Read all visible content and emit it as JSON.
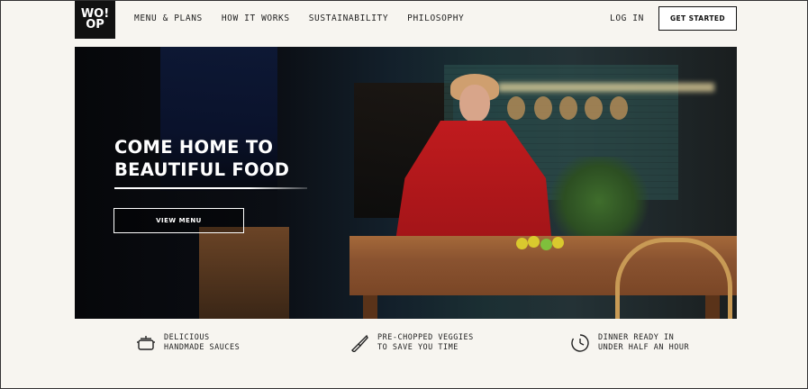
{
  "brand": {
    "logo_line1": "WO!",
    "logo_line2": "OP"
  },
  "nav": {
    "items": [
      {
        "label": "MENU & PLANS"
      },
      {
        "label": "HOW IT WORKS"
      },
      {
        "label": "SUSTAINABILITY"
      },
      {
        "label": "PHILOSOPHY"
      }
    ],
    "login": "LOG IN",
    "cta": "GET STARTED"
  },
  "hero": {
    "title": "COME HOME TO\nBEAUTIFUL FOOD",
    "button": "VIEW MENU"
  },
  "features": [
    {
      "icon": "pot-icon",
      "text": "DELICIOUS\nHANDMADE SAUCES"
    },
    {
      "icon": "knife-icon",
      "text": "PRE-CHOPPED VEGGIES\nTO SAVE YOU TIME"
    },
    {
      "icon": "clock-icon",
      "text": "DINNER READY IN\nUNDER HALF AN HOUR"
    }
  ],
  "colors": {
    "background": "#f7f5f0",
    "logo_bg": "#111111",
    "coat_red": "#c01b1e"
  }
}
